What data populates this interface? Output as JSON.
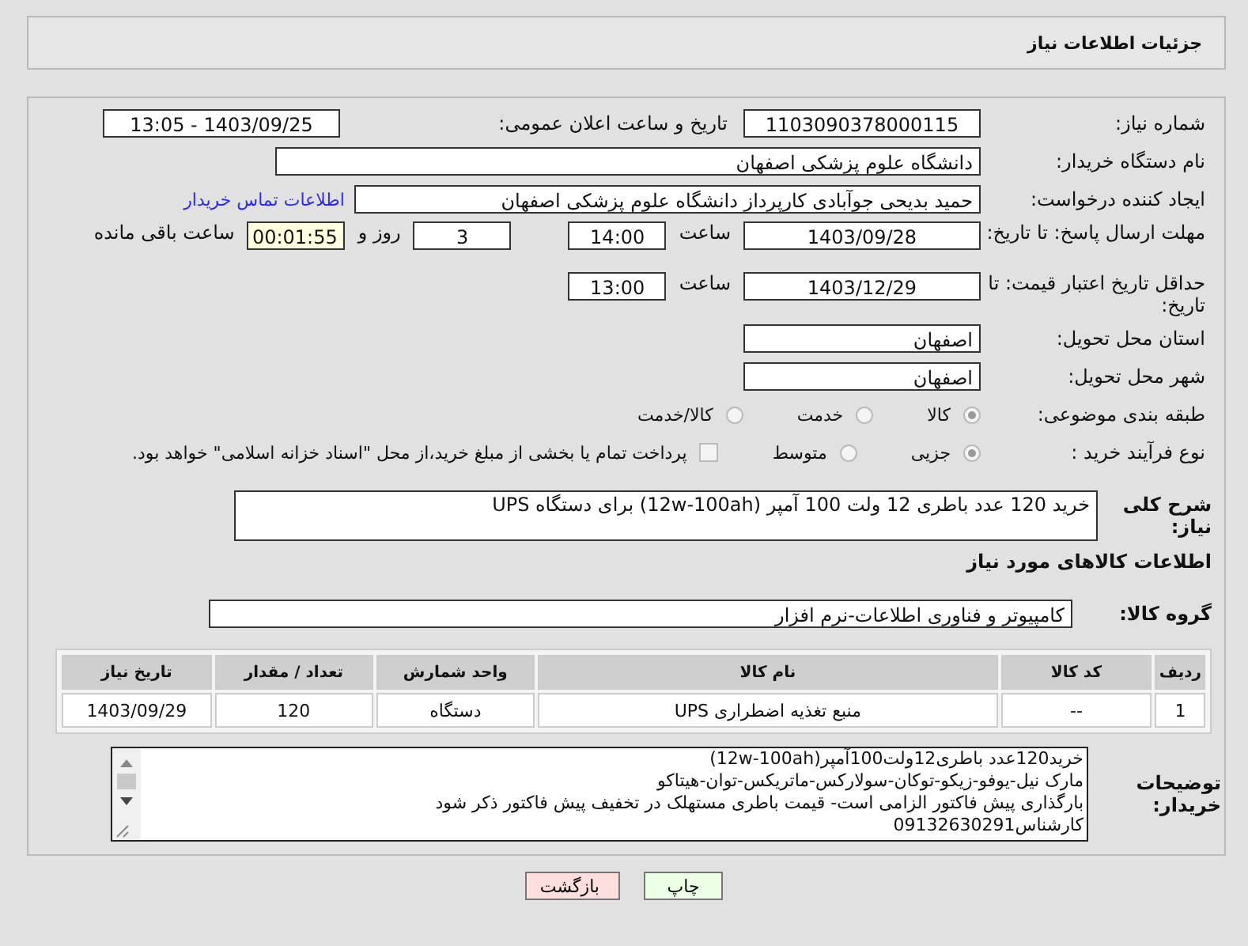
{
  "header": {
    "title": "جزئیات اطلاعات نیاز"
  },
  "need_number": {
    "label": "شماره نیاز:",
    "value": "1103090378000115"
  },
  "announce": {
    "label": "تاریخ و ساعت اعلان عمومی:",
    "value": "1403/09/25 - 13:05"
  },
  "buyer_org": {
    "label": "نام دستگاه خریدار:",
    "value": "دانشگاه علوم پزشکی اصفهان"
  },
  "requester": {
    "label": "ایجاد کننده درخواست:",
    "value": "حمید بدیحی جوآبادی کارپرداز دانشگاه علوم پزشکی اصفهان",
    "link": "اطلاعات تماس خریدار"
  },
  "reply_deadline": {
    "label": "مهلت ارسال پاسخ: تا تاریخ:",
    "date": "1403/09/28",
    "time_label": "ساعت",
    "time": "14:00",
    "days": "3",
    "days_label": "روز و",
    "remaining": "00:01:55",
    "remaining_label": "ساعت باقی مانده"
  },
  "validity_deadline": {
    "label": "حداقل تاریخ اعتبار قیمت: تا تاریخ:",
    "date": "1403/12/29",
    "time_label": "ساعت",
    "time": "13:00"
  },
  "province": {
    "label": "استان محل تحویل:",
    "value": "اصفهان"
  },
  "city": {
    "label": "شهر محل تحویل:",
    "value": "اصفهان"
  },
  "category": {
    "label": "طبقه بندی موضوعی:",
    "options": [
      {
        "label": "کالا",
        "selected": true
      },
      {
        "label": "خدمت",
        "selected": false
      },
      {
        "label": "کالا/خدمت",
        "selected": false
      }
    ]
  },
  "process": {
    "label": "نوع فرآیند خرید :",
    "options": [
      {
        "label": "جزیی",
        "selected": true
      },
      {
        "label": "متوسط",
        "selected": false
      }
    ],
    "treasury_checkbox": {
      "label": "پرداخت تمام یا بخشی از مبلغ خرید،از محل \"اسناد خزانه اسلامی\" خواهد بود.",
      "checked": false
    }
  },
  "description": {
    "label": "شرح کلی نیاز:",
    "value": "خرید 120 عدد باطری 12 ولت 100 آمپر (12w-100ah) برای دستگاه UPS"
  },
  "goods_title": "اطلاعات کالاهای مورد نیاز",
  "goods_group": {
    "label": "گروه کالا:",
    "value": "کامپیوتر و فناوری اطلاعات-نرم افزار"
  },
  "table": {
    "columns": [
      "ردیف",
      "کد کالا",
      "نام کالا",
      "واحد شمارش",
      "تعداد / مقدار",
      "تاریخ نیاز"
    ],
    "rows": [
      [
        "1",
        "--",
        "منبع تغذیه اضطراری UPS",
        "دستگاه",
        "120",
        "1403/09/29"
      ]
    ]
  },
  "buyer_notes": {
    "label": "توضیحات خریدار:",
    "lines": [
      "خرید120عدد باطری12ولت100آمپر(12w-100ah)",
      "مارک نیل-یوفو-زیکو-توکان-سولارکس-ماتریکس-توان-هیتاکو",
      "بارگذاری پیش فاکتور الزامی است- قیمت باطری مستهلک در تخفیف پیش فاکتور ذکر شود",
      "کارشناس09132630291"
    ]
  },
  "buttons": [
    {
      "kind": "print",
      "label": "چاپ"
    },
    {
      "kind": "back",
      "label": "بازگشت"
    }
  ]
}
